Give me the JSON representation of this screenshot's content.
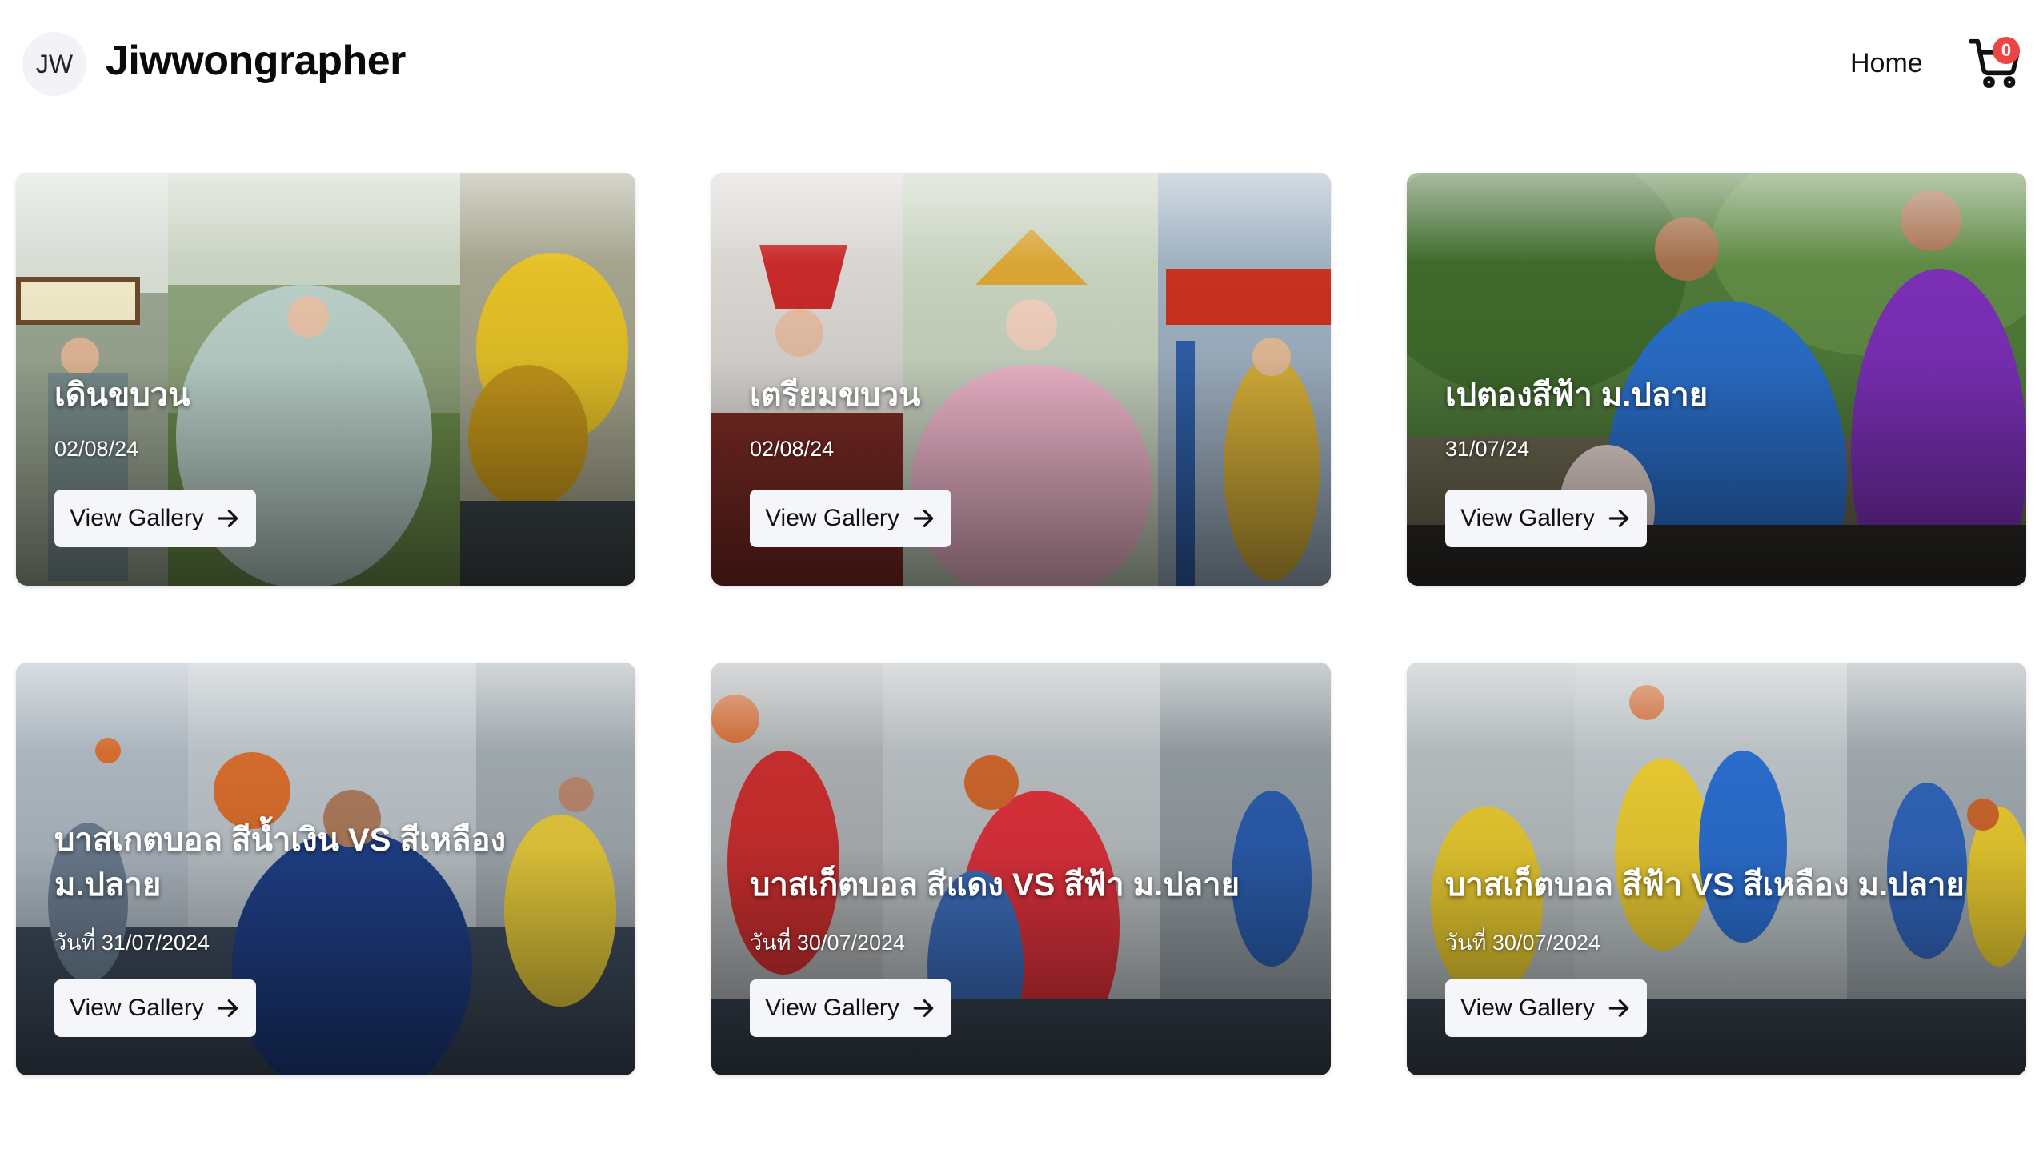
{
  "header": {
    "avatar_initials": "JW",
    "brand": "Jiwwongrapher",
    "nav_home": "Home",
    "cart_icon": "shopping-cart-icon",
    "cart_count": "0"
  },
  "cards": [
    {
      "title": "เดินขบวน",
      "date": "02/08/24",
      "button": "View Gallery"
    },
    {
      "title": "เตรียมขบวน",
      "date": "02/08/24",
      "button": "View Gallery"
    },
    {
      "title": "เปตองสีฟ้า ม.ปลาย",
      "date": "31/07/24",
      "button": "View Gallery"
    },
    {
      "title": "บาสเกตบอล สีน้ำเงิน VS สีเหลือง ม.ปลาย",
      "date": "วันที่ 31/07/2024",
      "button": "View Gallery"
    },
    {
      "title": "บาสเก็ตบอล สีแดง VS สีฟ้า ม.ปลาย",
      "date": "วันที่ 30/07/2024",
      "button": "View Gallery"
    },
    {
      "title": "บาสเก็ตบอล สีฟ้า VS สีเหลือง ม.ปลาย",
      "date": "วันที่ 30/07/2024",
      "button": "View Gallery"
    }
  ],
  "colors": {
    "badge": "#ef4444",
    "button_bg": "#f4f6fa",
    "avatar_bg": "#f1f3f6"
  }
}
